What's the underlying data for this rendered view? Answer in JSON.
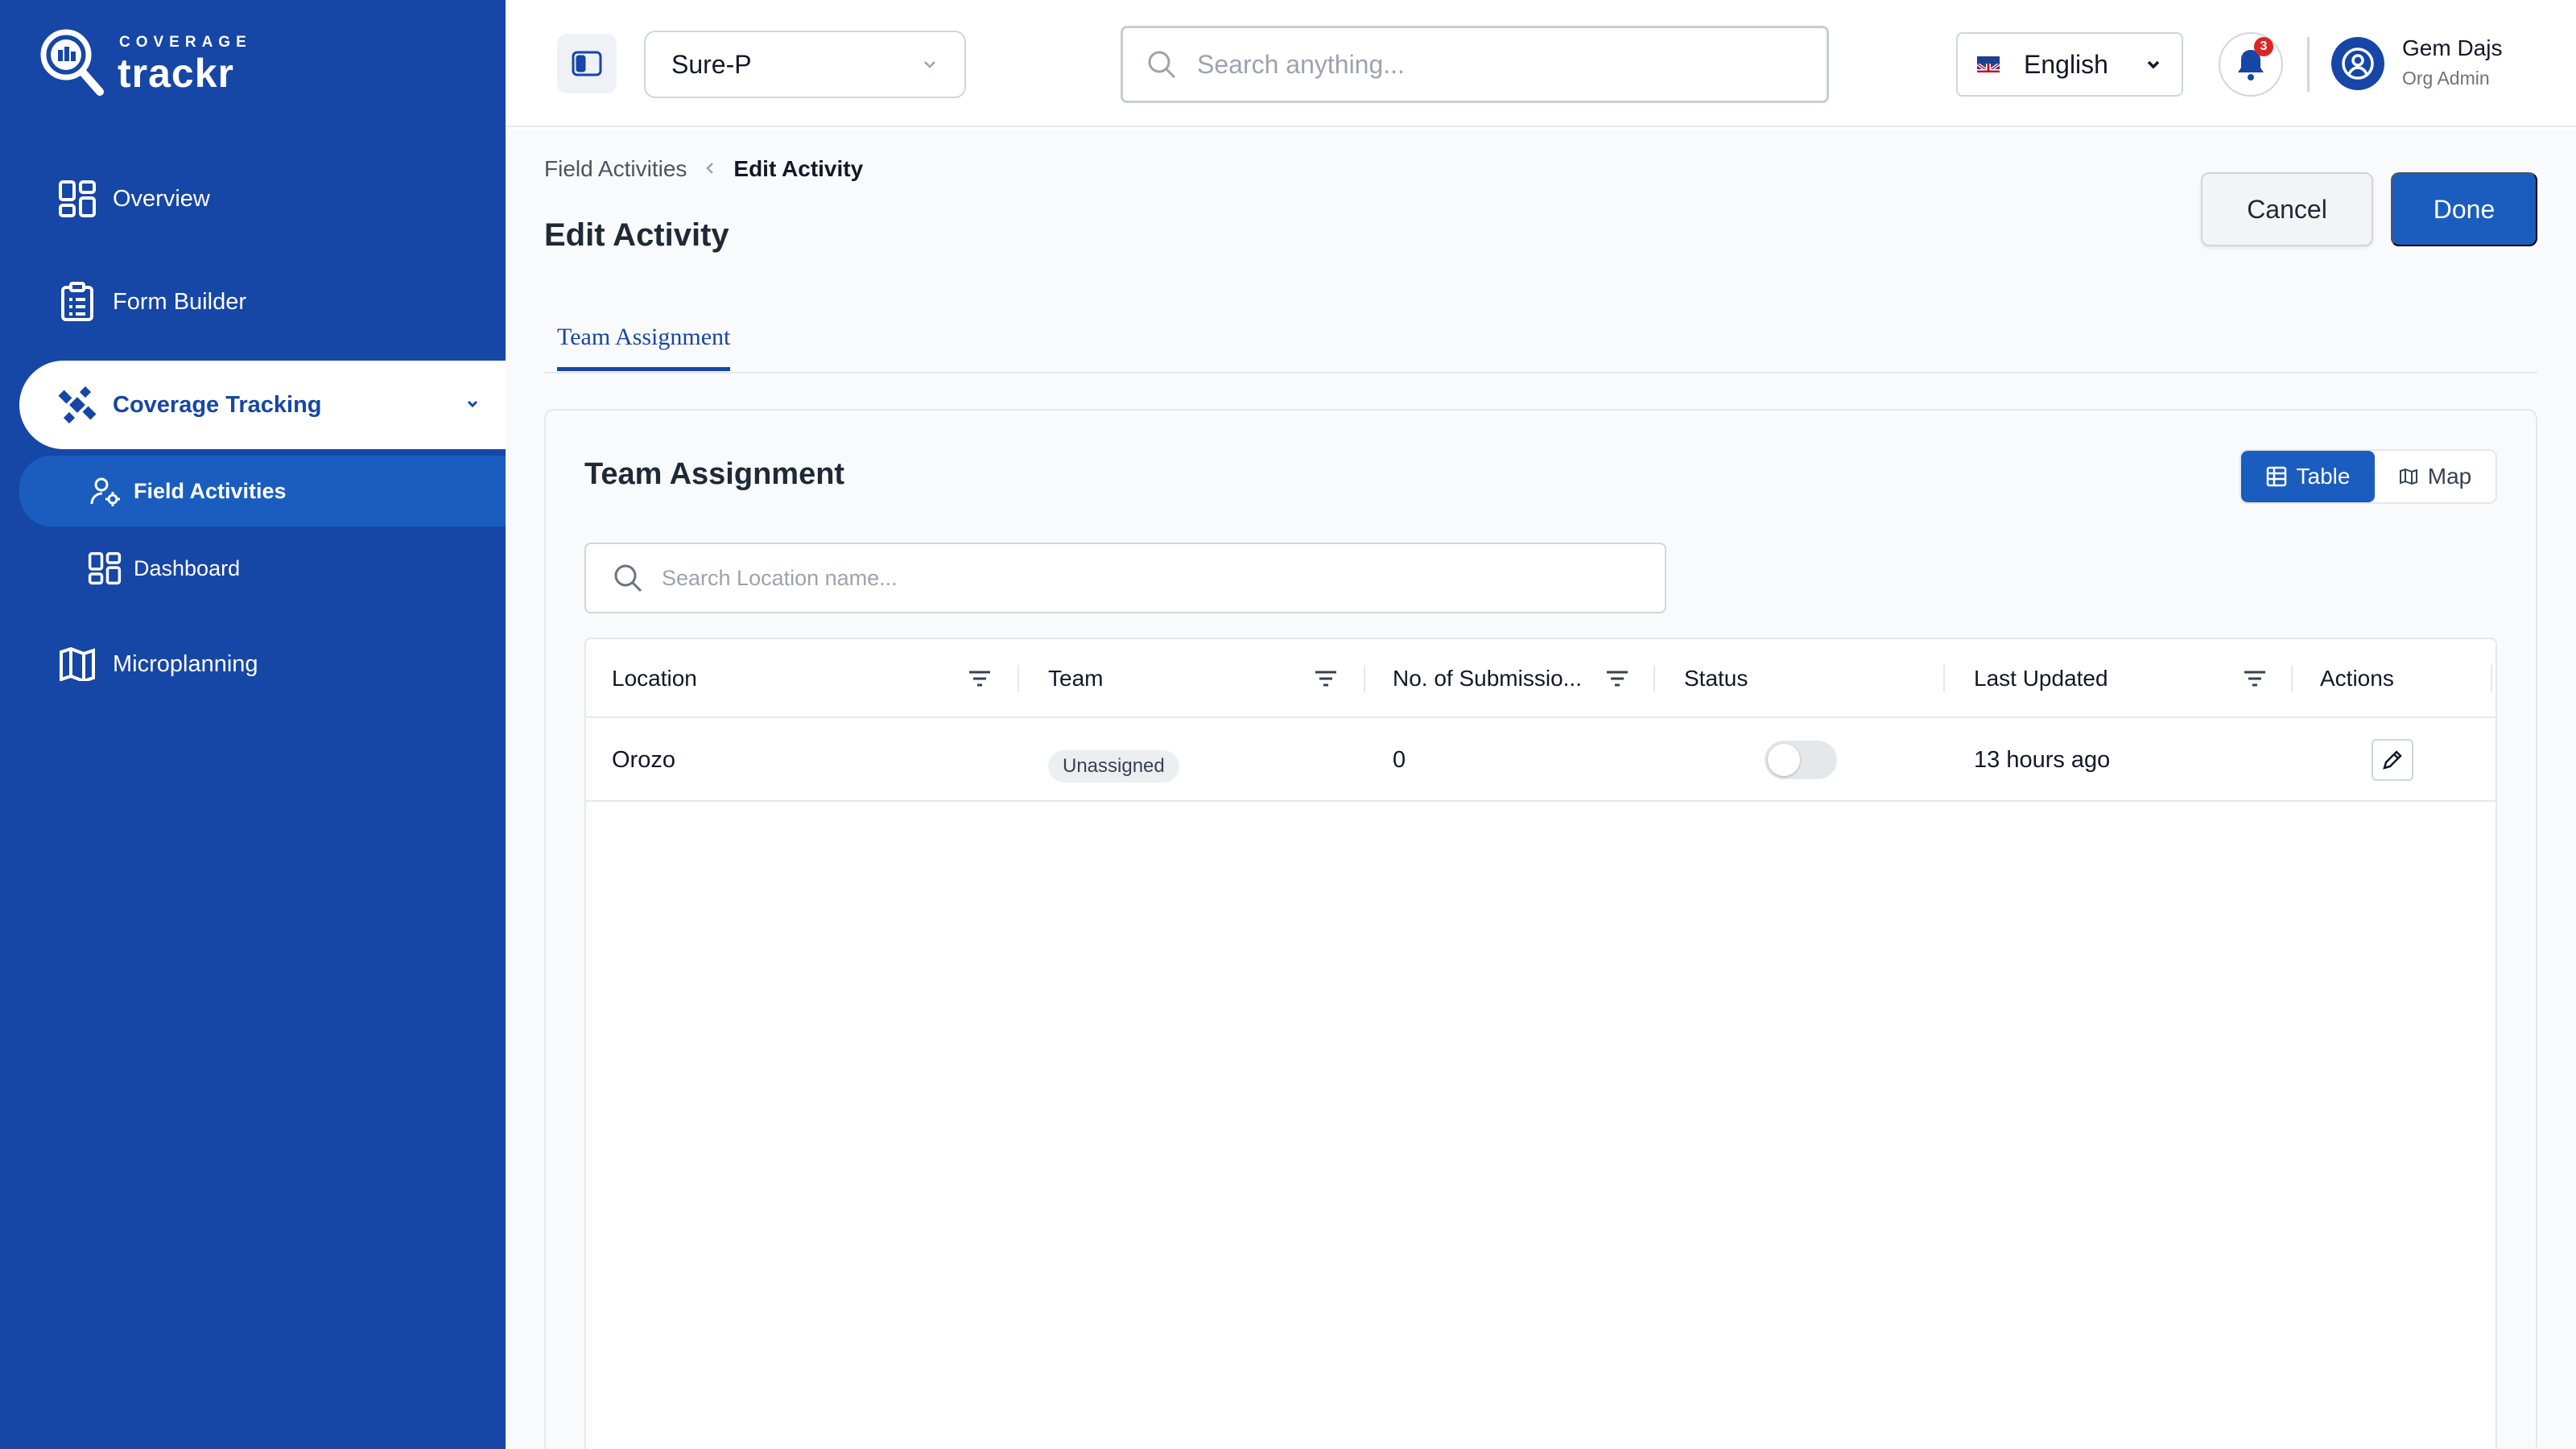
{
  "brand": {
    "small": "COVERAGE",
    "big": "trackr"
  },
  "sidebar": {
    "items": [
      {
        "label": "Overview",
        "icon": "overview-grid-icon"
      },
      {
        "label": "Form Builder",
        "icon": "clipboard-icon"
      },
      {
        "label": "Coverage Tracking",
        "icon": "satellite-icon",
        "active": true,
        "expanded": true
      },
      {
        "label": "Microplanning",
        "icon": "map-book-icon"
      }
    ],
    "sub_items": [
      {
        "label": "Field Activities",
        "icon": "user-gear-icon",
        "active": true
      },
      {
        "label": "Dashboard",
        "icon": "dashboard-grid-icon"
      }
    ]
  },
  "header": {
    "project": "Sure-P",
    "search_placeholder": "Search anything...",
    "language": "English",
    "notification_count": "3",
    "user_name": "Gem Dajs",
    "user_role": "Org Admin"
  },
  "breadcrumb": {
    "parent": "Field Activities",
    "current": "Edit Activity"
  },
  "page": {
    "title": "Edit Activity",
    "cancel_label": "Cancel",
    "done_label": "Done",
    "tabs": [
      {
        "label": "Team Assignment",
        "active": true
      }
    ]
  },
  "panel": {
    "title": "Team Assignment",
    "view_table_label": "Table",
    "view_map_label": "Map",
    "search_placeholder": "Search Location name..."
  },
  "table": {
    "columns": [
      "Location",
      "Team",
      "No. of Submissio...",
      "Status",
      "Last Updated",
      "Actions"
    ],
    "rows": [
      {
        "location": "Orozo",
        "team": "Unassigned",
        "submissions": "0",
        "status": false,
        "last_updated": "13 hours ago"
      }
    ]
  },
  "colors": {
    "sidebar": "#1646a6",
    "accent": "#1a5dbf",
    "badge": "#dc2626"
  }
}
